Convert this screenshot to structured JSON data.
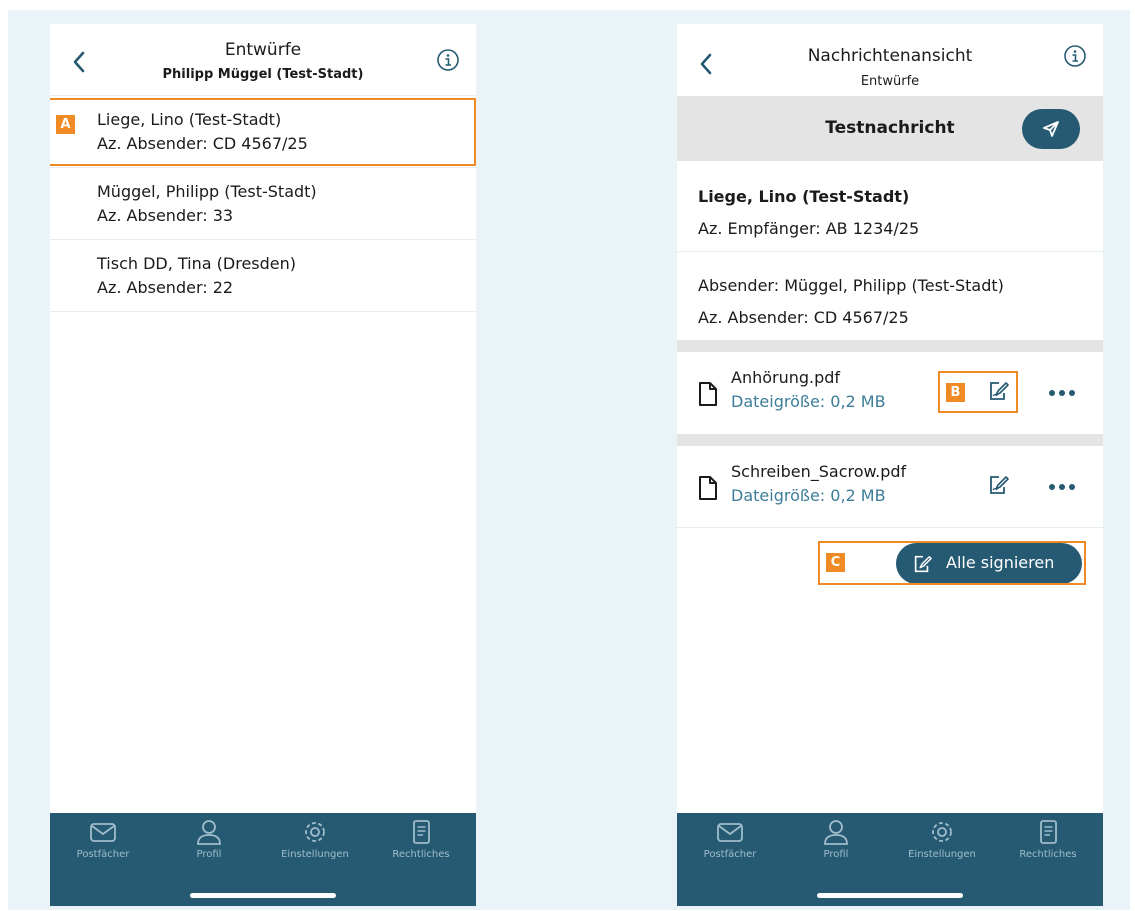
{
  "left_screen": {
    "header": {
      "title": "Entwürfe",
      "subtitle": "Philipp Müggel (Test-Stadt)"
    },
    "drafts": [
      {
        "name": "Liege, Lino (Test-Stadt)",
        "ref": "Az. Absender: CD 4567/25"
      },
      {
        "name": "Müggel, Philipp (Test-Stadt)",
        "ref": "Az. Absender: 33"
      },
      {
        "name": "Tisch DD, Tina (Dresden)",
        "ref": "Az. Absender: 22"
      }
    ]
  },
  "right_screen": {
    "header": {
      "title": "Nachrichtenansicht",
      "subtitle": "Entwürfe"
    },
    "subject": "Testnachricht",
    "recipient": {
      "name": "Liege, Lino (Test-Stadt)",
      "ref": "Az. Empfänger: AB 1234/25"
    },
    "sender": {
      "name": "Absender: Müggel, Philipp (Test-Stadt)",
      "ref": "Az. Absender: CD 4567/25"
    },
    "attachments": [
      {
        "name": "Anhörung.pdf",
        "size": "Dateigröße: 0,2 MB"
      },
      {
        "name": "Schreiben_Sacrow.pdf",
        "size": "Dateigröße: 0,2 MB"
      }
    ],
    "sign_all_label": "Alle signieren"
  },
  "tabbar": {
    "tabs": [
      {
        "label": "Postfächer",
        "icon": "envelope-icon"
      },
      {
        "label": "Profil",
        "icon": "person-icon"
      },
      {
        "label": "Einstellungen",
        "icon": "gear-icon"
      },
      {
        "label": "Rechtliches",
        "icon": "document-icon"
      }
    ]
  },
  "markers": {
    "a": "A",
    "b": "B",
    "c": "C"
  },
  "colors": {
    "accent": "#265a73",
    "marker": "#f08a24",
    "link": "#3d7d99",
    "background": "#eaf3f7"
  }
}
